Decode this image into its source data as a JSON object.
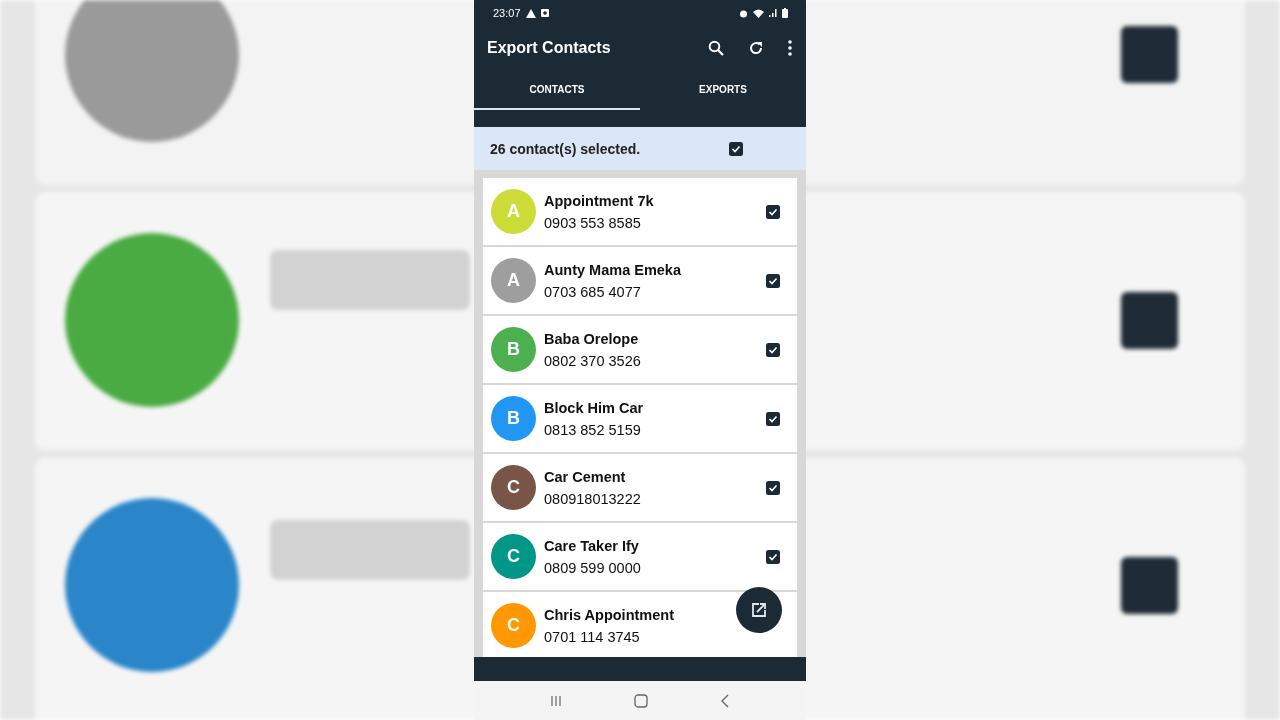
{
  "status_bar": {
    "time": "23:07"
  },
  "app_bar": {
    "title": "Export Contacts"
  },
  "tabs": [
    {
      "label": "CONTACTS",
      "selected": true
    },
    {
      "label": "EXPORTS",
      "selected": false
    }
  ],
  "selection_bar": {
    "text": "26 contact(s) selected.",
    "checked": true
  },
  "contacts": [
    {
      "initial": "A",
      "color": "#cddc39",
      "name": "Appointment 7k",
      "phone": "0903 553 8585",
      "checked": true
    },
    {
      "initial": "A",
      "color": "#9e9e9e",
      "name": "Aunty Mama Emeka",
      "phone": "0703 685 4077",
      "checked": true
    },
    {
      "initial": "B",
      "color": "#4caf50",
      "name": "Baba Orelope",
      "phone": "0802 370 3526",
      "checked": true
    },
    {
      "initial": "B",
      "color": "#2196f3",
      "name": "Block Him Car",
      "phone": "0813 852 5159",
      "checked": true
    },
    {
      "initial": "C",
      "color": "#795548",
      "name": "Car Cement",
      "phone": "080918013222",
      "checked": true
    },
    {
      "initial": "C",
      "color": "#009688",
      "name": "Care Taker Ify",
      "phone": "0809 599 0000",
      "checked": true
    },
    {
      "initial": "C",
      "color": "#ff9800",
      "name": "Chris Appointment",
      "phone": "0701 114 3745"
    }
  ]
}
